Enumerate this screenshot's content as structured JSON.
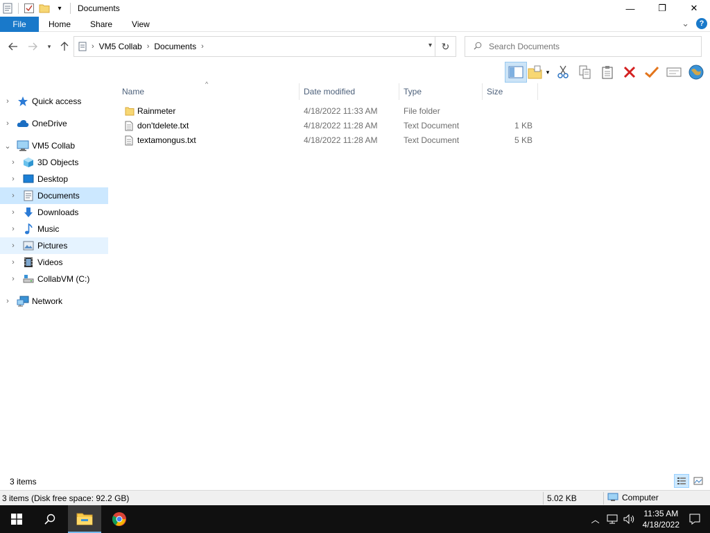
{
  "window": {
    "title": "Documents",
    "minimize_glyph": "—",
    "maximize_glyph": "❐",
    "close_glyph": "✕"
  },
  "ribbon": {
    "file": "File",
    "tabs": [
      "Home",
      "Share",
      "View"
    ],
    "expand_glyph": "⌄",
    "help_glyph": "?"
  },
  "address": {
    "crumbs": [
      "VM5 Collab",
      "Documents"
    ],
    "chevron": "›"
  },
  "search": {
    "placeholder": "Search Documents"
  },
  "nav_pane": {
    "items": [
      {
        "label": "Quick access",
        "icon": "star-icon"
      },
      {
        "label": "OneDrive",
        "icon": "cloud-icon"
      },
      {
        "label": "VM5 Collab",
        "icon": "computer-icon"
      },
      {
        "label": "3D Objects",
        "icon": "cube-icon"
      },
      {
        "label": "Desktop",
        "icon": "desktop-icon"
      },
      {
        "label": "Documents",
        "icon": "documents-icon"
      },
      {
        "label": "Downloads",
        "icon": "download-icon"
      },
      {
        "label": "Music",
        "icon": "music-icon"
      },
      {
        "label": "Pictures",
        "icon": "pictures-icon"
      },
      {
        "label": "Videos",
        "icon": "video-icon"
      },
      {
        "label": "CollabVM (C:)",
        "icon": "drive-icon"
      },
      {
        "label": "Network",
        "icon": "network-icon"
      }
    ]
  },
  "file_list": {
    "columns": [
      "Name",
      "Date modified",
      "Type",
      "Size"
    ],
    "rows": [
      {
        "name": "Rainmeter",
        "date": "4/18/2022 11:33 AM",
        "type": "File folder",
        "size": ""
      },
      {
        "name": "don'tdelete.txt",
        "date": "4/18/2022 11:28 AM",
        "type": "Text Document",
        "size": "1 KB"
      },
      {
        "name": "textamongus.txt",
        "date": "4/18/2022 11:28 AM",
        "type": "Text Document",
        "size": "5 KB"
      }
    ]
  },
  "status": {
    "item_count": "3 items",
    "disk_info": "3 items (Disk free space: 92.2 GB)",
    "size": "5.02 KB",
    "location": "Computer"
  },
  "taskbar": {
    "time": "11:35 AM",
    "date": "4/18/2022"
  },
  "colors": {
    "accent": "#1979ca",
    "selected": "#cce8ff",
    "taskbar": "#101010"
  }
}
